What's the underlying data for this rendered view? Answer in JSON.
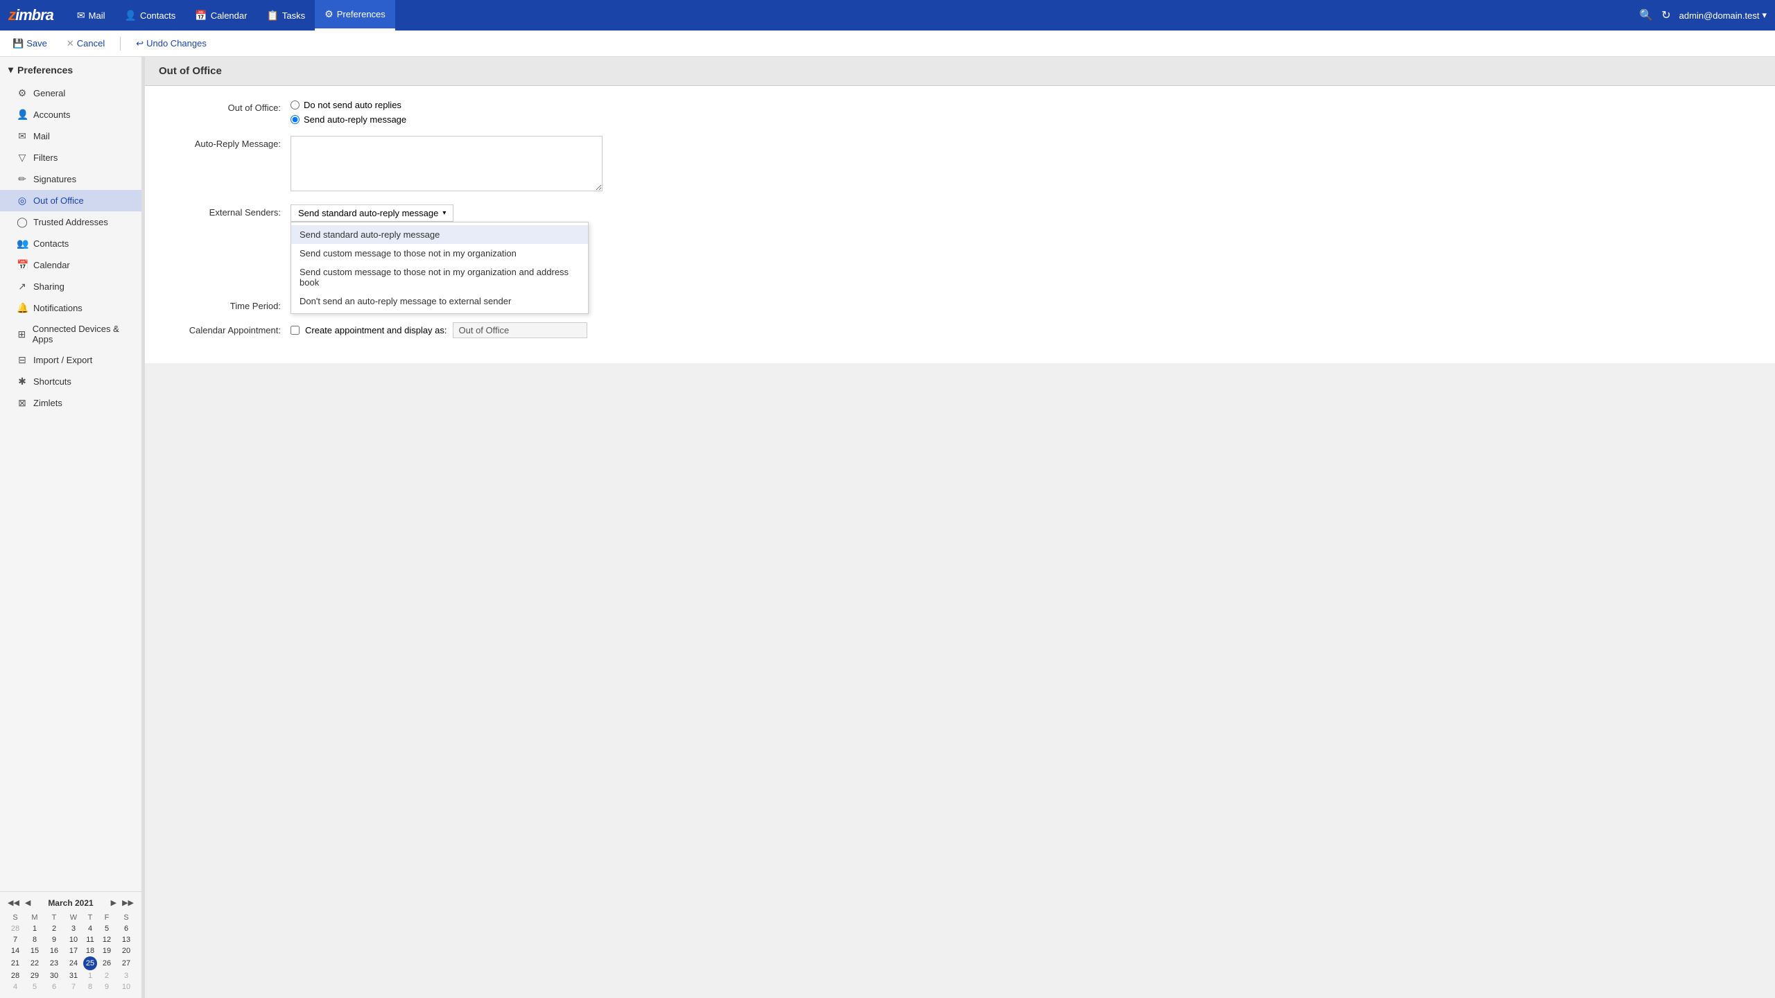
{
  "app": {
    "name": "Zimbra",
    "logoText": "zimbra"
  },
  "topNav": {
    "items": [
      {
        "id": "mail",
        "label": "Mail",
        "icon": "✉"
      },
      {
        "id": "contacts",
        "label": "Contacts",
        "icon": "👤"
      },
      {
        "id": "calendar",
        "label": "Calendar",
        "icon": "📅"
      },
      {
        "id": "tasks",
        "label": "Tasks",
        "icon": "📋"
      },
      {
        "id": "preferences",
        "label": "Preferences",
        "icon": "⚙",
        "active": true
      }
    ],
    "userEmail": "admin@domain.test",
    "searchIcon": "🔍",
    "refreshIcon": "↻"
  },
  "toolbar": {
    "saveLabel": "Save",
    "cancelLabel": "Cancel",
    "undoLabel": "Undo Changes"
  },
  "sidebar": {
    "headerLabel": "Preferences",
    "items": [
      {
        "id": "general",
        "label": "General",
        "icon": "⚙"
      },
      {
        "id": "accounts",
        "label": "Accounts",
        "icon": "👤"
      },
      {
        "id": "mail",
        "label": "Mail",
        "icon": "✉"
      },
      {
        "id": "filters",
        "label": "Filters",
        "icon": "▽"
      },
      {
        "id": "signatures",
        "label": "Signatures",
        "icon": "✏"
      },
      {
        "id": "out-of-office",
        "label": "Out of Office",
        "icon": "◎",
        "active": true
      },
      {
        "id": "trusted-addresses",
        "label": "Trusted Addresses",
        "icon": "◯"
      },
      {
        "id": "contacts",
        "label": "Contacts",
        "icon": "👥"
      },
      {
        "id": "calendar",
        "label": "Calendar",
        "icon": "📅"
      },
      {
        "id": "sharing",
        "label": "Sharing",
        "icon": "↗"
      },
      {
        "id": "notifications",
        "label": "Notifications",
        "icon": "🔔"
      },
      {
        "id": "connected-devices",
        "label": "Connected Devices & Apps",
        "icon": "⊞"
      },
      {
        "id": "import-export",
        "label": "Import / Export",
        "icon": "⊟"
      },
      {
        "id": "shortcuts",
        "label": "Shortcuts",
        "icon": "✱"
      },
      {
        "id": "zimlets",
        "label": "Zimlets",
        "icon": "⊠"
      }
    ]
  },
  "calendar": {
    "title": "March 2021",
    "dayHeaders": [
      "S",
      "M",
      "T",
      "W",
      "T",
      "F",
      "S"
    ],
    "weeks": [
      [
        {
          "day": 28,
          "other": true
        },
        {
          "day": 1
        },
        {
          "day": 2
        },
        {
          "day": 3
        },
        {
          "day": 4
        },
        {
          "day": 5
        },
        {
          "day": 6
        }
      ],
      [
        {
          "day": 7
        },
        {
          "day": 8
        },
        {
          "day": 9
        },
        {
          "day": 10
        },
        {
          "day": 11
        },
        {
          "day": 12
        },
        {
          "day": 13
        }
      ],
      [
        {
          "day": 14
        },
        {
          "day": 15
        },
        {
          "day": 16
        },
        {
          "day": 17
        },
        {
          "day": 18
        },
        {
          "day": 19
        },
        {
          "day": 20
        }
      ],
      [
        {
          "day": 21
        },
        {
          "day": 22
        },
        {
          "day": 23
        },
        {
          "day": 24
        },
        {
          "day": 25,
          "today": true
        },
        {
          "day": 26
        },
        {
          "day": 27
        }
      ],
      [
        {
          "day": 28
        },
        {
          "day": 29
        },
        {
          "day": 30
        },
        {
          "day": 31
        },
        {
          "day": 1,
          "other": true
        },
        {
          "day": 2,
          "other": true
        },
        {
          "day": 3,
          "other": true
        }
      ],
      [
        {
          "day": 4,
          "other": true
        },
        {
          "day": 5,
          "other": true
        },
        {
          "day": 6,
          "other": true
        },
        {
          "day": 7,
          "other": true
        },
        {
          "day": 8,
          "other": true
        },
        {
          "day": 9,
          "other": true
        },
        {
          "day": 10,
          "other": true
        }
      ]
    ]
  },
  "outOfOffice": {
    "pageTitle": "Out of Office",
    "outOfOfficeLabel": "Out of Office:",
    "radio1Label": "Do not send auto replies",
    "radio2Label": "Send auto-reply message",
    "autoReplyLabel": "Auto-Reply Message:",
    "autoReplyValue": "",
    "autoReplyPlaceholder": "",
    "externalSendersLabel": "External Senders:",
    "selectedOption": "Send standard auto-reply message",
    "dropdownOptions": [
      "Send standard auto-reply message",
      "Send custom message to those not in my organization",
      "Send custom message to those not in my organization and address book",
      "Don't send an auto-reply message to external sender"
    ],
    "timePeriodLabel": "Time Period:",
    "calAppointmentLabel": "Calendar Appointment:",
    "createApptLabel": "Create appointment and display as:",
    "displayAsValue": "Out of Office"
  }
}
